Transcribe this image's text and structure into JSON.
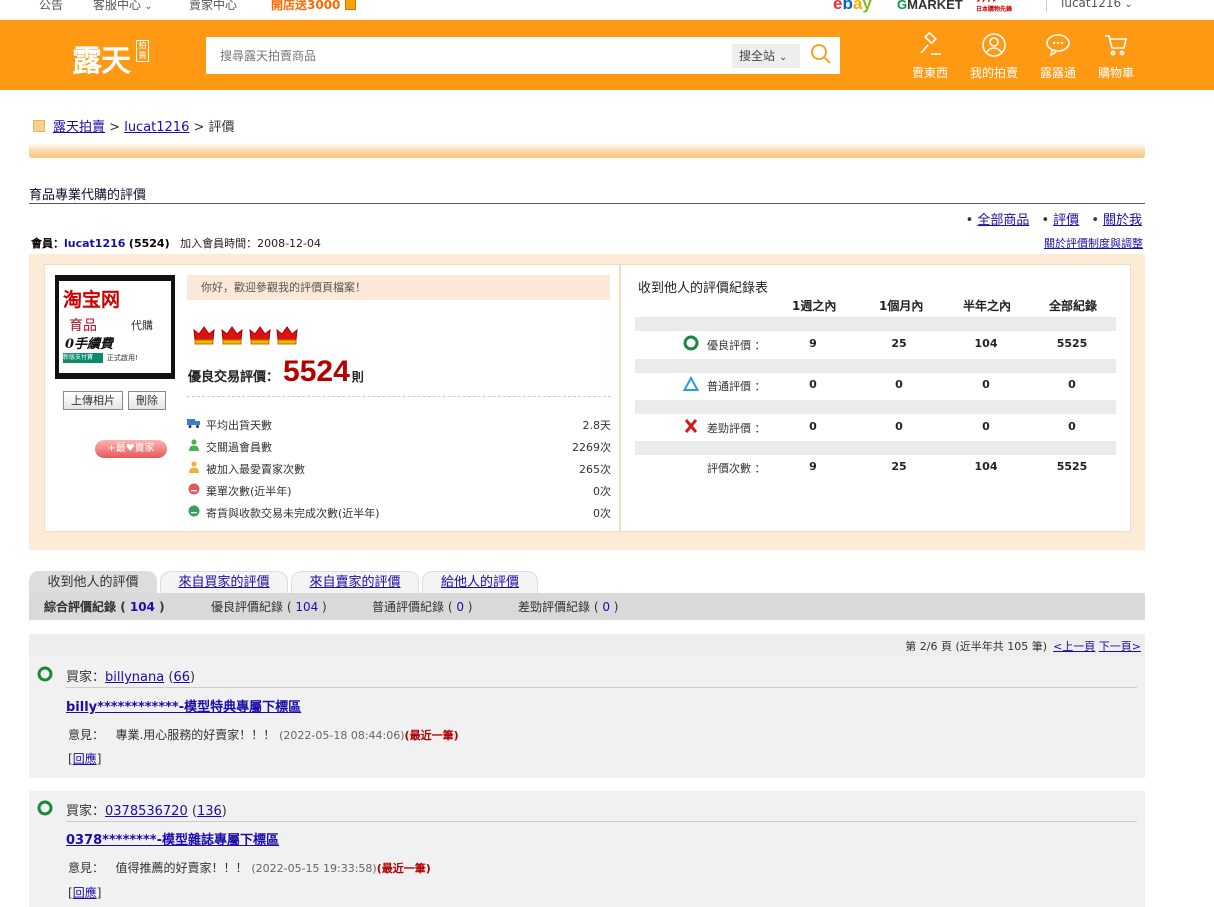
{
  "topbar": {
    "announcement": "公告",
    "service_center": "客服中心",
    "seller_center": "賣家中心",
    "promo": "開店送3000",
    "partners": [
      "ebay",
      "Gmarket",
      "日本樂天"
    ],
    "rakuten_sub": "日本購物先鋒",
    "username": "lucat1216"
  },
  "header": {
    "logo": "露天",
    "logo_badge": "拍賣",
    "search_placeholder": "搜尋露天拍賣商品",
    "search_scope": "搜全站",
    "nav": [
      {
        "icon": "gavel-icon",
        "label": "賣東西"
      },
      {
        "icon": "user-icon",
        "label": "我的拍賣"
      },
      {
        "icon": "chat-icon",
        "label": "露露通"
      },
      {
        "icon": "cart-icon",
        "label": "購物車"
      }
    ]
  },
  "breadcrumb": {
    "home": "露天拍賣",
    "sep": ">",
    "user": "lucat1216",
    "current": "評價"
  },
  "store": {
    "title": "育品專業代購的評價",
    "links": [
      "全部商品",
      "評價",
      "關於我"
    ],
    "member_label": "會員：",
    "member_name": "lucat1216",
    "member_score": "(5524)",
    "join_label": "加入會員時間：",
    "join_date": "2008-12-04",
    "rules_link": "關於評價制度與調整"
  },
  "profile": {
    "avatar_text": [
      "淘宝网",
      "育品",
      "0手續費",
      "新版支付寶",
      "正式啟用!",
      "代購"
    ],
    "upload_btn": "上傳相片",
    "delete_btn": "刪除",
    "fav_btn": "+最♥賣家",
    "welcome": "你好，歡迎參觀我的評價頁檔案！",
    "rating_label": "優良交易評價：",
    "rating_value": "5524",
    "rating_unit": "則",
    "stats": [
      {
        "icon": "truck-icon",
        "label": "平均出貨天數",
        "value": "2.8天"
      },
      {
        "icon": "member-icon",
        "label": "交關過會員數",
        "value": "2269次"
      },
      {
        "icon": "favorite-member-icon",
        "label": "被加入最愛賣家次數",
        "value": "265次"
      },
      {
        "icon": "abandon-icon",
        "label": "棄單次數(近半年)",
        "value": "0次"
      },
      {
        "icon": "incomplete-icon",
        "label": "寄貨與收款交易未完成次數(近半年)",
        "value": "0次"
      }
    ]
  },
  "records": {
    "title": "收到他人的評價紀錄表",
    "headers": [
      "1週之內",
      "1個月內",
      "半年之內",
      "全部紀錄"
    ],
    "rows": [
      {
        "icon": "good-circle-icon",
        "label": "優良評價 ：",
        "values": [
          "9",
          "25",
          "104",
          "5525"
        ]
      },
      {
        "icon": "neutral-triangle-icon",
        "label": "普通評價 ：",
        "values": [
          "0",
          "0",
          "0",
          "0"
        ]
      },
      {
        "icon": "bad-x-icon",
        "label": "差勁評價 ：",
        "values": [
          "0",
          "0",
          "0",
          "0"
        ]
      },
      {
        "icon": "",
        "label": "評價次數 ：",
        "values": [
          "9",
          "25",
          "104",
          "5525"
        ]
      }
    ]
  },
  "tabs": [
    "收到他人的評價",
    "來自買家的評價",
    "來自賣家的評價",
    "給他人的評價"
  ],
  "subtabs": [
    {
      "label": "綜合評價紀錄",
      "count": "104"
    },
    {
      "label": "優良評價紀錄",
      "count": "104"
    },
    {
      "label": "普通評價紀錄",
      "count": "0"
    },
    {
      "label": "差勁評價紀錄",
      "count": "0"
    }
  ],
  "pager": {
    "info": "第 2/6 頁 (近半年共 105 筆)",
    "prev": "<上一頁",
    "next": "下一頁>"
  },
  "reviews": [
    {
      "role": "買家：",
      "buyer": "billynana",
      "score": "66",
      "item": "billy************-模型特典專屬下標區",
      "comment_label": "意見：",
      "comment": "專業.用心服務的好賣家！！！",
      "timestamp": "(2022-05-18 08:44:06)",
      "latest": "(最近一筆)",
      "reply": "回應"
    },
    {
      "role": "買家：",
      "buyer": "0378536720",
      "score": "136",
      "item": "0378********-模型雜誌專屬下標區",
      "comment_label": "意見：",
      "comment": "值得推薦的好賣家！！！",
      "timestamp": "(2022-05-15 19:33:58)",
      "latest": "(最近一筆)",
      "reply": "回應"
    }
  ],
  "colors": {
    "brand_orange": "#ff9913",
    "panel_bg": "#fcebd7",
    "rating_red": "#b50000",
    "link_blue": "#1a0dab"
  }
}
